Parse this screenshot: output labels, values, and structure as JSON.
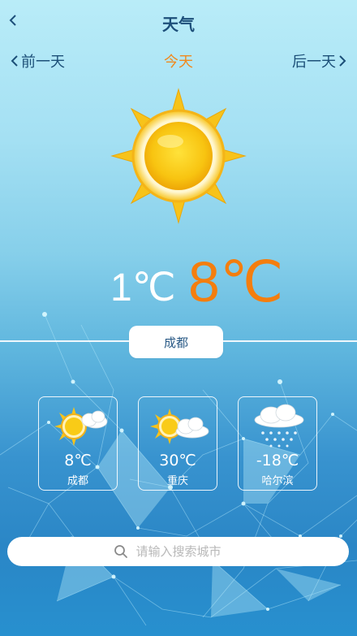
{
  "header": {
    "title": "天气"
  },
  "day_nav": {
    "prev_label": "前一天",
    "today_label": "今天",
    "next_label": "后一天"
  },
  "current": {
    "condition_icon": "sun-icon",
    "low_temp": "1℃",
    "high_temp": "8℃",
    "city": "成都"
  },
  "cities": [
    {
      "name": "成都",
      "temp": "8℃",
      "icon": "sun-behind-cloud-icon"
    },
    {
      "name": "重庆",
      "temp": "30℃",
      "icon": "sun-behind-cloud-icon"
    },
    {
      "name": "哈尔滨",
      "temp": "-18℃",
      "icon": "snow-cloud-icon"
    }
  ],
  "search": {
    "placeholder": "请输入搜索城市",
    "value": ""
  },
  "colors": {
    "title": "#1d4f7a",
    "today": "#f0891e",
    "high_temp": "#f47e0e",
    "sun": "#f7c31a"
  }
}
